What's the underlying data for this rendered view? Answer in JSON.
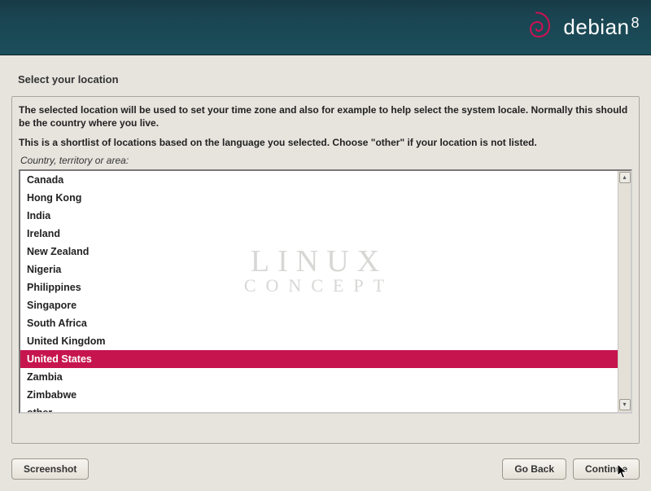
{
  "brand": {
    "name": "debian",
    "version": "8"
  },
  "title": "Select your location",
  "description": "The selected location will be used to set your time zone and also for example to help select the system locale. Normally this should be the country where you live.",
  "subdescription": "This is a shortlist of locations based on the language you selected. Choose \"other\" if your location is not listed.",
  "list_label": "Country, territory or area:",
  "watermark": {
    "line1": "LINUX",
    "line2": "CONCEPT"
  },
  "countries": [
    "Canada",
    "Hong Kong",
    "India",
    "Ireland",
    "New Zealand",
    "Nigeria",
    "Philippines",
    "Singapore",
    "South Africa",
    "United Kingdom",
    "United States",
    "Zambia",
    "Zimbabwe",
    "other"
  ],
  "selected_index": 10,
  "buttons": {
    "screenshot": "Screenshot",
    "goback": "Go Back",
    "continue": "Continue"
  }
}
